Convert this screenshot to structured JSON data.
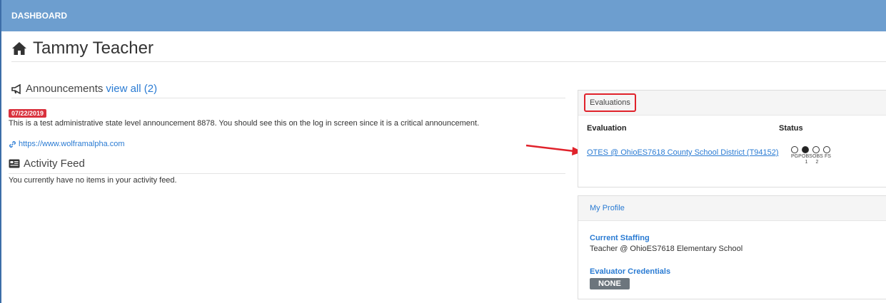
{
  "topbar": {
    "title": "DASHBOARD"
  },
  "page": {
    "title": "Tammy Teacher",
    "icon": "home-icon"
  },
  "announcements": {
    "heading": "Announcements",
    "view_all": "view all (2)",
    "icon": "megaphone-icon",
    "items": [
      {
        "date": "07/22/2019",
        "text": "This is a test administrative state level announcement 8878. You should see this on the log in screen since it is a critical announcement.",
        "link": "https://www.wolframalpha.com"
      }
    ]
  },
  "activity_feed": {
    "heading": "Activity Feed",
    "icon": "newspaper-icon",
    "empty_text": "You currently have no items in your activity feed."
  },
  "evaluations": {
    "heading": "Evaluations",
    "col_evaluation": "Evaluation",
    "col_status": "Status",
    "rows": [
      {
        "name": "OTES @ OhioES7618 County School District (T94152)",
        "status": [
          {
            "label": "PGP",
            "filled": false
          },
          {
            "label": "OBS 1",
            "filled": true
          },
          {
            "label": "OBS 2",
            "filled": false
          },
          {
            "label": "FS",
            "filled": false
          }
        ]
      }
    ]
  },
  "profile": {
    "heading": "My Profile",
    "staffing_label": "Current Staffing",
    "staffing_value": "Teacher @ OhioES7618 Elementary School",
    "credentials_label": "Evaluator Credentials",
    "credentials_value": "NONE"
  },
  "colors": {
    "topbar": "#6d9ecf",
    "link": "#2a7bd3",
    "badge": "#d9313d",
    "highlight": "#e0222b"
  }
}
